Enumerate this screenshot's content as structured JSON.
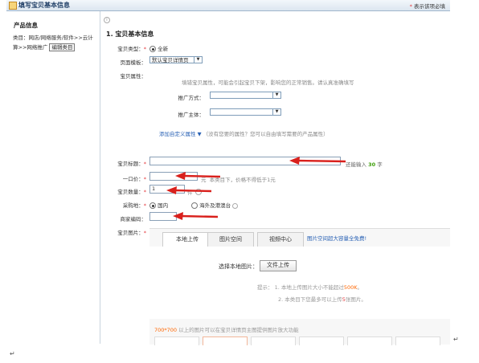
{
  "header": {
    "title": "填写宝贝基本信息",
    "required_star": "*",
    "required_text": "表示该项必填"
  },
  "sidebar": {
    "title": "产品信息",
    "category": "类目：网店/网络服务/软件>>云计算>>网络推广",
    "edit_label": "编辑类目"
  },
  "info_icon": "i",
  "section": {
    "title": "1. 宝贝基本信息"
  },
  "form": {
    "type": {
      "label": "宝贝类型：",
      "star": "*",
      "option": "全新",
      "selected": true
    },
    "template": {
      "label": "页面模板：",
      "value": "默认宝贝详情页"
    },
    "attrs": {
      "label": "宝贝属性：",
      "hint": "填错宝贝属性，可能会引起宝贝下架，影响您的正常销售。请认真准确填写",
      "promo_method": {
        "label": "推广方式：",
        "value": ""
      },
      "promo_subject": {
        "label": "推广主体：",
        "value": ""
      },
      "custom_link": "添加自定义属性",
      "custom_hint": "（没有您要的属性？您可以自由填写需要的产品属性）"
    },
    "title_field": {
      "label": "宝贝标题：",
      "star": "*",
      "value": "",
      "count_prefix": "还能输入",
      "count": "30",
      "count_suffix": "字"
    },
    "price": {
      "label": "一口价：",
      "star": "*",
      "value": "",
      "unit": "元",
      "hint": "本类目下，价格不得低于1元"
    },
    "quantity": {
      "label": "宝贝数量：",
      "star": "*",
      "value": "1",
      "unit": "件"
    },
    "origin": {
      "label": "采购地：",
      "star": "*",
      "opt1": "国内",
      "opt2": "海外及港澳台"
    },
    "merchant_code": {
      "label": "商家编码：",
      "value": ""
    },
    "images": {
      "label": "宝贝图片：",
      "star": "*"
    }
  },
  "image_panel": {
    "tabs": [
      "本地上传",
      "图片空间",
      "视频中心"
    ],
    "tab_link": "图片空间超大容量全免费!",
    "choose_label": "选择本地图片：",
    "upload_button": "文件上传",
    "hint1_pre": "提示：  1. 本地上传图片大小不能超过",
    "hint1_val": "500K",
    "hint1_post": "。",
    "hint2_pre": "2. 本类目下您最多可以上传",
    "hint2_val": "5",
    "hint2_post": "张图片。",
    "bottom_note_val": "700*700",
    "bottom_note_rest": "以上的图片可以在宝贝详情页主图提供图片放大功能"
  },
  "para_marks": [
    "↵",
    "↵"
  ],
  "colors": {
    "arrow": "#d9201c",
    "accent_link": "#2a62b5",
    "required": "#e4393c",
    "count_green": "#3b9d07"
  }
}
